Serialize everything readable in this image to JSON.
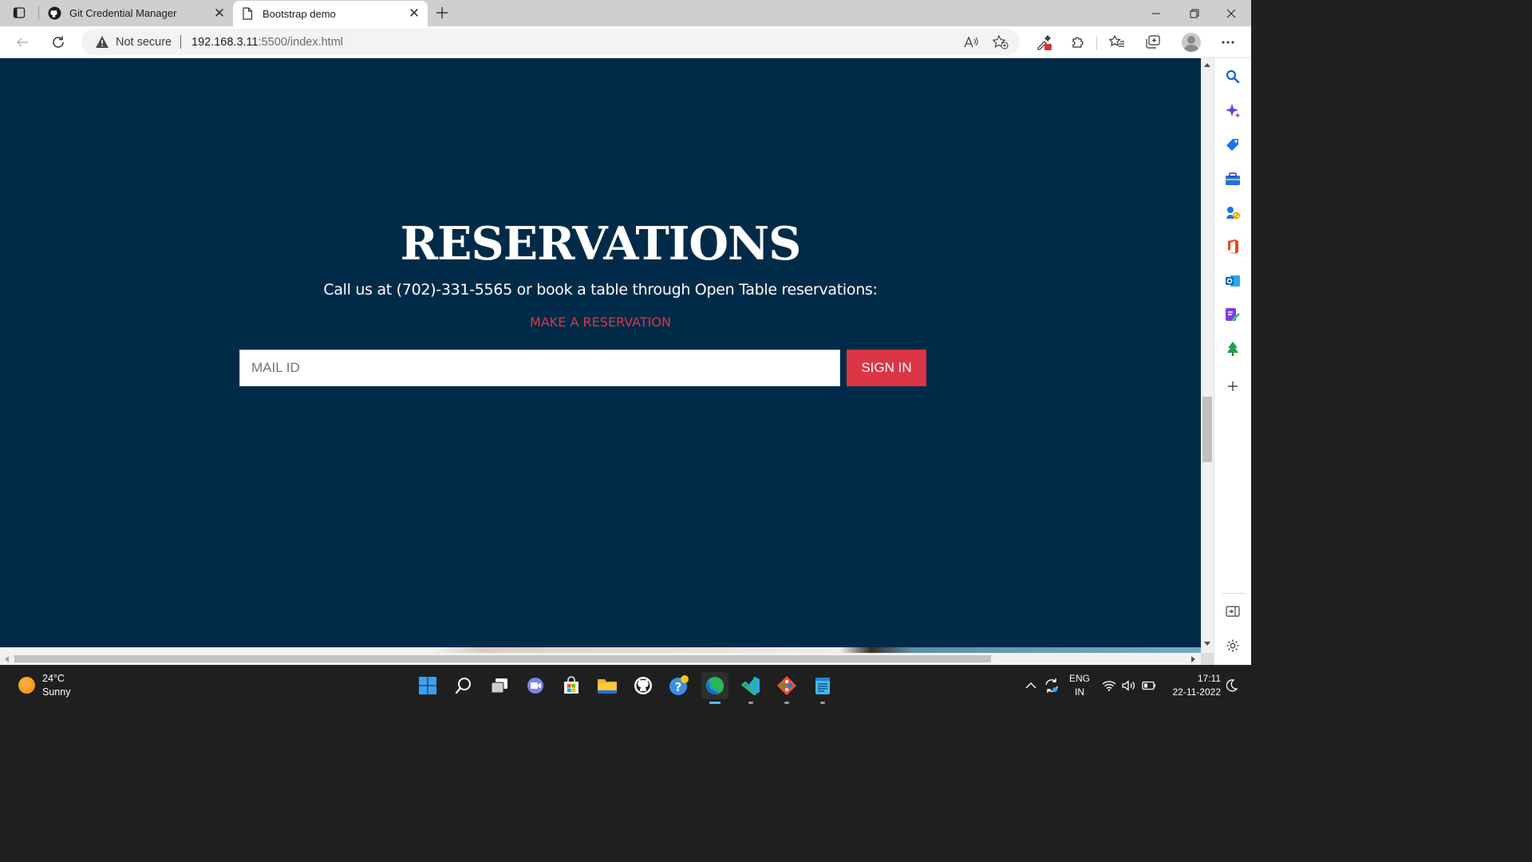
{
  "browser": {
    "tabs": [
      {
        "title": "Git Credential Manager",
        "favicon": "github-icon",
        "active": false
      },
      {
        "title": "Bootstrap demo",
        "favicon": "page-icon",
        "active": true
      }
    ],
    "address": {
      "security_label": "Not secure",
      "url_host": "192.168.3.11",
      "url_rest": ":5500/index.html"
    },
    "sidebar_icons": [
      "search-icon",
      "copilot-icon",
      "shopping-tag-icon",
      "tools-icon",
      "games-icon",
      "office-icon",
      "outlook-icon",
      "designer-icon",
      "tree-icon",
      "add-icon",
      "panel-toggle-icon",
      "settings-icon"
    ]
  },
  "page": {
    "title": "RESERVATIONS",
    "subtitle": "Call us at (702)-331-5565 or book a table through Open Table reservations:",
    "link_label": "MAKE A RESERVATION",
    "email_placeholder": "MAIL ID",
    "signin_label": "SIGN IN",
    "colors": {
      "background": "#002b48",
      "accent": "#dc3545",
      "text": "#ffffff"
    }
  },
  "taskbar": {
    "weather": {
      "temp": "24°C",
      "condition": "Sunny"
    },
    "apps": [
      "start-icon",
      "search-icon",
      "task-view-icon",
      "teams-chat-icon",
      "store-icon",
      "file-explorer-icon",
      "github-desktop-icon",
      "help-icon",
      "edge-icon",
      "vscode-icon",
      "git-icon",
      "notepad-icon"
    ],
    "language": {
      "line1": "ENG",
      "line2": "IN"
    },
    "clock": {
      "time": "17:11",
      "date": "22-11-2022"
    }
  }
}
